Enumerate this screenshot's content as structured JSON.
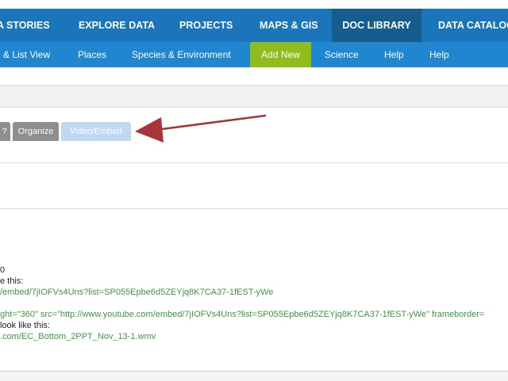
{
  "top_nav": {
    "items": [
      "A STORIES",
      "EXPLORE DATA",
      "PROJECTS",
      "MAPS & GIS",
      "DOC LIBRARY",
      "DATA CATALOG"
    ]
  },
  "sub_nav": {
    "items": [
      "& List View",
      "Places",
      "Species & Environment",
      "Add New",
      "Science",
      "Help",
      "Help"
    ]
  },
  "toolbar": {
    "buttons": [
      "?",
      "Organize",
      "Video/Embed"
    ]
  },
  "content": {
    "lines": [
      "0",
      "e this:",
      "/embed/7jIOFVs4Uns?list=SP055Epbe6d5ZEYjq8K7CA37-1fEST-yWe",
      "ght=\"360\" src=\"http://www.youtube.com/embed/7jIOFVs4Uns?list=SP055Epbe6d5ZEYjq8K7CA37-1fEST-yWe\" frameborder=",
      "look like this:",
      ".com/EC_Bottom_2PPT_Nov_13-1.wmv"
    ]
  },
  "colors": {
    "top_nav_bg": "#1b75bb",
    "top_nav_active": "#155c8f",
    "sub_nav_bg": "#1f86cf",
    "add_new": "#8fbd1b",
    "link_green": "#3d9a3d",
    "arrow": "#a8343a"
  },
  "icons": {
    "annotation_arrow": "arrow-pointing-left-icon"
  }
}
